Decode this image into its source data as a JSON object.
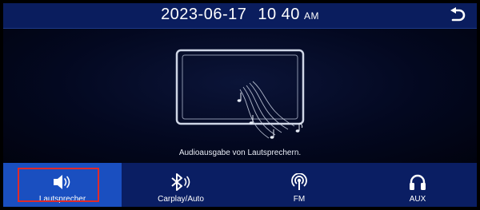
{
  "status_bar": {
    "date": "2023-06-17",
    "time": "10 40",
    "ampm": "AM"
  },
  "main": {
    "message": "Audioausgabe von Lautsprechern."
  },
  "tabs": [
    {
      "label": "Lautsprecher",
      "icon": "speaker-icon",
      "selected": true
    },
    {
      "label": "Carplay/Auto",
      "icon": "bluetooth-audio-icon",
      "selected": false
    },
    {
      "label": "FM",
      "icon": "radio-broadcast-icon",
      "selected": false
    },
    {
      "label": "AUX",
      "icon": "headphones-icon",
      "selected": false
    }
  ],
  "colors": {
    "top_bar": "#0a1d5e",
    "bottom_bar": "#0a1e63",
    "active_tab": "#1a4fc0",
    "highlight_border": "#e02a2a"
  }
}
